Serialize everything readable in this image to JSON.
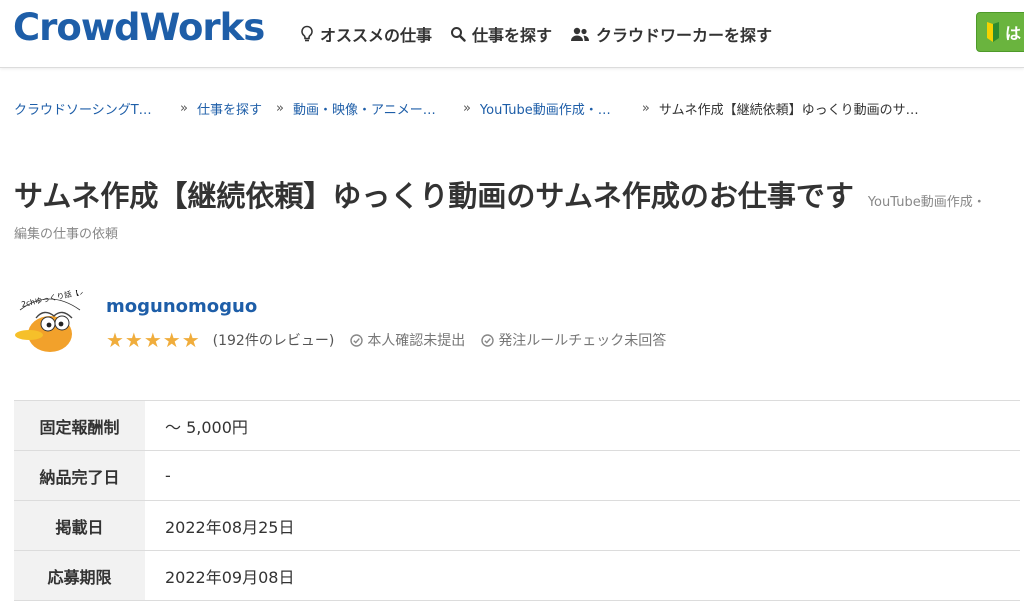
{
  "header": {
    "logo": "CrowdWorks",
    "nav": [
      {
        "label": "オススメの仕事",
        "icon": "lightbulb-icon"
      },
      {
        "label": "仕事を探す",
        "icon": "search-icon"
      },
      {
        "label": "クラウドワーカーを探す",
        "icon": "users-icon"
      }
    ],
    "signup_label": "は",
    "colors": {
      "brand": "#1e5ea8",
      "signup": "#6ab43e"
    }
  },
  "breadcrumb": {
    "items": [
      "クラウドソーシングT…",
      "仕事を探す",
      "動画・映像・アニメー…",
      "YouTube動画作成・…"
    ],
    "current": "サムネ作成【継続依頼】ゆっくり動画のサ…",
    "separator": "»"
  },
  "job": {
    "title": "サムネ作成【継続依頼】ゆっくり動画のサムネ作成のお仕事です",
    "category_line1": "YouTube動画作成・",
    "category_line2": "編集の仕事の依頼"
  },
  "client": {
    "name": "mogunomoguo",
    "stars": "★★★★★",
    "rating": 5,
    "reviews": "(192件のレビュー)",
    "identity_status": "本人確認未提出",
    "rule_check_status": "発注ルールチェック未回答",
    "avatar_text": "2chゆっくり話【スカッと】"
  },
  "details": [
    {
      "label": "固定報酬制",
      "value": "〜 5,000円"
    },
    {
      "label": "納品完了日",
      "value": "-"
    },
    {
      "label": "掲載日",
      "value": "2022年08月25日"
    },
    {
      "label": "応募期限",
      "value": "2022年09月08日"
    }
  ]
}
